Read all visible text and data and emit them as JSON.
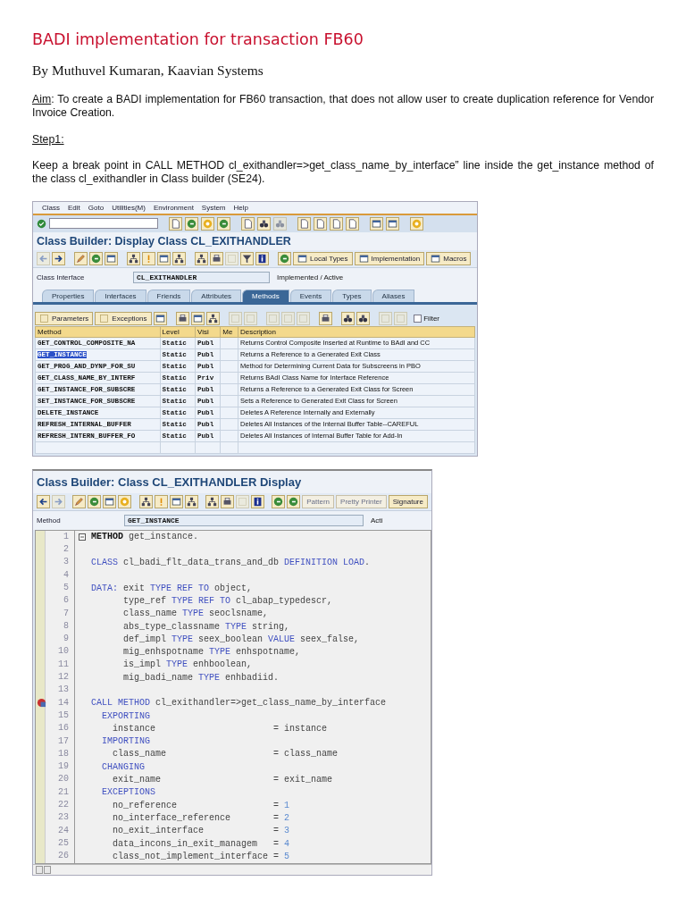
{
  "document": {
    "title": "BADI implementation for transaction FB60",
    "byline": "By Muthuvel Kumaran, Kaavian Systems",
    "aim_label": "Aim",
    "aim_text": ": To create a BADI implementation for FB60 transaction, that does not allow user to create duplication reference for Vendor Invoice Creation.",
    "step_label": "Step1:",
    "instruction": "Keep a break point in CALL METHOD cl_exithandler=>get_class_name_by_interface” line inside the get_instance method of the class cl_exithandler in Class builder (SE24)."
  },
  "screen_1": {
    "menu": [
      "Class",
      "Edit",
      "Goto",
      "Utilities(M)",
      "Environment",
      "System",
      "Help"
    ],
    "title": "Class Builder: Display Class CL_EXITHANDLER",
    "toolbar_buttons": [
      {
        "label": "Local Types",
        "disabled": false
      },
      {
        "label": "Implementation",
        "disabled": false
      },
      {
        "label": "Macros",
        "disabled": false
      }
    ],
    "field_label": "Class Interface",
    "field_value": "CL_EXITHANDLER",
    "status": "Implemented / Active",
    "tabs": [
      {
        "label": "Properties",
        "selected": false
      },
      {
        "label": "Interfaces",
        "selected": false
      },
      {
        "label": "Friends",
        "selected": false
      },
      {
        "label": "Attributes",
        "selected": false
      },
      {
        "label": "Methods",
        "selected": true
      },
      {
        "label": "Events",
        "selected": false
      },
      {
        "label": "Types",
        "selected": false
      },
      {
        "label": "Aliases",
        "selected": false
      }
    ],
    "table_buttons": [
      "Parameters",
      "Exceptions"
    ],
    "filter": {
      "label": "Filter",
      "checked": false
    },
    "columns": [
      "Method",
      "Level",
      "Visi",
      "Me",
      "Description"
    ],
    "rows": [
      {
        "cells": [
          "GET_CONTROL_COMPOSITE_NA",
          "Static",
          "Publ",
          "",
          "Returns Control Composite Inserted at Runtime to BAdI and CC"
        ],
        "selected": false
      },
      {
        "cells": [
          "GET_INSTANCE",
          "Static",
          "Publ",
          "",
          "Returns a Reference to a Generated Exit Class"
        ],
        "selected": true
      },
      {
        "cells": [
          "GET_PROG_AND_DYNP_FOR_SU",
          "Static",
          "Publ",
          "",
          "Method for Determining Current Data for Subscreens in PBO"
        ],
        "selected": false
      },
      {
        "cells": [
          "GET_CLASS_NAME_BY_INTERF",
          "Static",
          "Priv",
          "",
          "Returns BAdI Class Name for Interface Reference"
        ],
        "selected": false
      },
      {
        "cells": [
          "GET_INSTANCE_FOR_SUBSCRE",
          "Static",
          "Publ",
          "",
          "Returns a Reference to a Generated Exit Class for Screen"
        ],
        "selected": false
      },
      {
        "cells": [
          "SET_INSTANCE_FOR_SUBSCRE",
          "Static",
          "Publ",
          "",
          "Sets a Reference to Generated Exit Class for Screen"
        ],
        "selected": false
      },
      {
        "cells": [
          "DELETE_INSTANCE",
          "Static",
          "Publ",
          "",
          "Deletes A Reference Internally and Externally"
        ],
        "selected": false
      },
      {
        "cells": [
          "REFRESH_INTERNAL_BUFFER",
          "Static",
          "Publ",
          "",
          "Deletes All Instances of the Internal Buffer Table--CAREFUL"
        ],
        "selected": false
      },
      {
        "cells": [
          "REFRESH_INTERN_BUFFER_FO",
          "Static",
          "Publ",
          "",
          "Deletes All Instances of Internal Buffer Table for Add-In"
        ],
        "selected": false
      }
    ]
  },
  "screen_2": {
    "title": "Class Builder: Class CL_EXITHANDLER Display",
    "toolbar_buttons": [
      {
        "label": "Pattern",
        "disabled": true
      },
      {
        "label": "Pretty Printer",
        "disabled": true
      },
      {
        "label": "Signature",
        "disabled": false
      }
    ],
    "field_label": "Method",
    "field_value": "GET_INSTANCE",
    "status": "Acti",
    "code": [
      {
        "number": "1",
        "breakpoint": false,
        "block_start": true,
        "segments": [
          {
            "text": "METHOD",
            "kind": "statement"
          },
          {
            "text": " get_instance.",
            "kind": "plain"
          }
        ]
      },
      {
        "number": "2",
        "breakpoint": false,
        "block_start": false
      },
      {
        "number": "3",
        "breakpoint": false,
        "block_start": false,
        "segments": [
          {
            "text": "  CLASS",
            "kind": "keyword"
          },
          {
            "text": " cl_badi_flt_data_trans_and_db ",
            "kind": "plain"
          },
          {
            "text": "DEFINITION LOAD",
            "kind": "keyword"
          },
          {
            "text": ".",
            "kind": "plain"
          }
        ]
      },
      {
        "number": "4",
        "breakpoint": false,
        "block_start": false
      },
      {
        "number": "5",
        "breakpoint": false,
        "block_start": false,
        "segments": [
          {
            "text": "  DATA:",
            "kind": "keyword"
          },
          {
            "text": " exit ",
            "kind": "plain"
          },
          {
            "text": "TYPE REF TO",
            "kind": "keyword"
          },
          {
            "text": " object,",
            "kind": "plain"
          }
        ]
      },
      {
        "number": "6",
        "breakpoint": false,
        "block_start": false,
        "segments": [
          {
            "text": "        type_ref ",
            "kind": "plain"
          },
          {
            "text": "TYPE REF TO",
            "kind": "keyword"
          },
          {
            "text": " cl_abap_typedescr,",
            "kind": "plain"
          }
        ]
      },
      {
        "number": "7",
        "breakpoint": false,
        "block_start": false,
        "segments": [
          {
            "text": "        class_name ",
            "kind": "plain"
          },
          {
            "text": "TYPE",
            "kind": "keyword"
          },
          {
            "text": " seoclsname,",
            "kind": "plain"
          }
        ]
      },
      {
        "number": "8",
        "breakpoint": false,
        "block_start": false,
        "segments": [
          {
            "text": "        abs_type_classname ",
            "kind": "plain"
          },
          {
            "text": "TYPE",
            "kind": "keyword"
          },
          {
            "text": " string,",
            "kind": "plain"
          }
        ]
      },
      {
        "number": "9",
        "breakpoint": false,
        "block_start": false,
        "segments": [
          {
            "text": "        def_impl ",
            "kind": "plain"
          },
          {
            "text": "TYPE",
            "kind": "keyword"
          },
          {
            "text": " seex_boolean ",
            "kind": "plain"
          },
          {
            "text": "VALUE",
            "kind": "keyword"
          },
          {
            "text": " seex_false,",
            "kind": "plain"
          }
        ]
      },
      {
        "number": "10",
        "breakpoint": false,
        "block_start": false,
        "segments": [
          {
            "text": "        mig_enhspotname ",
            "kind": "plain"
          },
          {
            "text": "TYPE",
            "kind": "keyword"
          },
          {
            "text": " enhspotname,",
            "kind": "plain"
          }
        ]
      },
      {
        "number": "11",
        "breakpoint": false,
        "block_start": false,
        "segments": [
          {
            "text": "        is_impl ",
            "kind": "plain"
          },
          {
            "text": "TYPE",
            "kind": "keyword"
          },
          {
            "text": " enhboolean,",
            "kind": "plain"
          }
        ]
      },
      {
        "number": "12",
        "breakpoint": false,
        "block_start": false,
        "segments": [
          {
            "text": "        mig_badi_name ",
            "kind": "plain"
          },
          {
            "text": "TYPE",
            "kind": "keyword"
          },
          {
            "text": " enhbadiid.",
            "kind": "plain"
          }
        ]
      },
      {
        "number": "13",
        "breakpoint": false,
        "block_start": false
      },
      {
        "number": "14",
        "breakpoint": true,
        "block_start": false,
        "segments": [
          {
            "text": "  CALL METHOD",
            "kind": "keyword"
          },
          {
            "text": " cl_exithandler=>get_class_name_by_interface",
            "kind": "plain"
          }
        ]
      },
      {
        "number": "15",
        "breakpoint": false,
        "block_start": false,
        "segments": [
          {
            "text": "    EXPORTING",
            "kind": "keyword"
          }
        ]
      },
      {
        "number": "16",
        "breakpoint": false,
        "block_start": false,
        "segments": [
          {
            "text": "      instance                      = instance",
            "kind": "plain"
          }
        ]
      },
      {
        "number": "17",
        "breakpoint": false,
        "block_start": false,
        "segments": [
          {
            "text": "    IMPORTING",
            "kind": "keyword"
          }
        ]
      },
      {
        "number": "18",
        "breakpoint": false,
        "block_start": false,
        "segments": [
          {
            "text": "      class_name                    = class_name",
            "kind": "plain"
          }
        ]
      },
      {
        "number": "19",
        "breakpoint": false,
        "block_start": false,
        "segments": [
          {
            "text": "    CHANGING",
            "kind": "keyword"
          }
        ]
      },
      {
        "number": "20",
        "breakpoint": false,
        "block_start": false,
        "segments": [
          {
            "text": "      exit_name                     = exit_name",
            "kind": "plain"
          }
        ]
      },
      {
        "number": "21",
        "breakpoint": false,
        "block_start": false,
        "segments": [
          {
            "text": "    EXCEPTIONS",
            "kind": "keyword"
          }
        ]
      },
      {
        "number": "22",
        "breakpoint": false,
        "block_start": false,
        "segments": [
          {
            "text": "      no_reference                  = ",
            "kind": "plain"
          },
          {
            "text": "1",
            "kind": "number"
          }
        ]
      },
      {
        "number": "23",
        "breakpoint": false,
        "block_start": false,
        "segments": [
          {
            "text": "      no_interface_reference        = ",
            "kind": "plain"
          },
          {
            "text": "2",
            "kind": "number"
          }
        ]
      },
      {
        "number": "24",
        "breakpoint": false,
        "block_start": false,
        "segments": [
          {
            "text": "      no_exit_interface             = ",
            "kind": "plain"
          },
          {
            "text": "3",
            "kind": "number"
          }
        ]
      },
      {
        "number": "25",
        "breakpoint": false,
        "block_start": false,
        "segments": [
          {
            "text": "      data_incons_in_exit_managem   = ",
            "kind": "plain"
          },
          {
            "text": "4",
            "kind": "number"
          }
        ]
      },
      {
        "number": "26",
        "breakpoint": false,
        "block_start": false,
        "segments": [
          {
            "text": "      class_not_implement_interface = ",
            "kind": "plain"
          },
          {
            "text": "5",
            "kind": "number"
          }
        ]
      }
    ]
  }
}
